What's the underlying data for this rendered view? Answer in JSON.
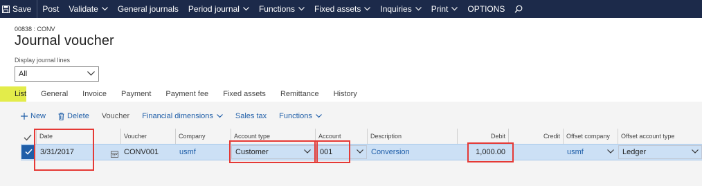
{
  "toolbar": {
    "save_label": "Save",
    "post_label": "Post",
    "validate_label": "Validate",
    "general_journals_label": "General journals",
    "period_journal_label": "Period journal",
    "functions_label": "Functions",
    "fixed_assets_label": "Fixed assets",
    "inquiries_label": "Inquiries",
    "print_label": "Print",
    "options_label": "OPTIONS"
  },
  "header": {
    "breadcrumb": "00838 : CONV",
    "title": "Journal voucher",
    "display_lines_label": "Display journal lines",
    "display_lines_value": "All"
  },
  "tabs": [
    "List",
    "General",
    "Invoice",
    "Payment",
    "Payment fee",
    "Fixed assets",
    "Remittance",
    "History"
  ],
  "grid_toolbar": {
    "new_label": "New",
    "delete_label": "Delete",
    "voucher_label": "Voucher",
    "financial_dimensions_label": "Financial dimensions",
    "sales_tax_label": "Sales tax",
    "functions_label": "Functions"
  },
  "columns": {
    "date": "Date",
    "voucher": "Voucher",
    "company": "Company",
    "account_type": "Account type",
    "account": "Account",
    "description": "Description",
    "debit": "Debit",
    "credit": "Credit",
    "offset_company": "Offset company",
    "offset_account_type": "Offset account type"
  },
  "row": {
    "date": "3/31/2017",
    "voucher": "CONV001",
    "company": "usmf",
    "account_type": "Customer",
    "account": "001",
    "description": "Conversion",
    "debit": "1,000.00",
    "credit": "",
    "offset_company": "usmf",
    "offset_account_type": "Ledger"
  },
  "colors": {
    "topbar": "#1c2a4a",
    "accent": "#1f5ea8",
    "active_tab": "#e3ec4a",
    "selected_row": "#cce0f5",
    "highlight": "#e53935"
  },
  "icons": [
    "save-icon",
    "chevron-down-icon",
    "search-icon",
    "plus-icon",
    "trash-icon",
    "calendar-icon",
    "checkmark-icon"
  ]
}
